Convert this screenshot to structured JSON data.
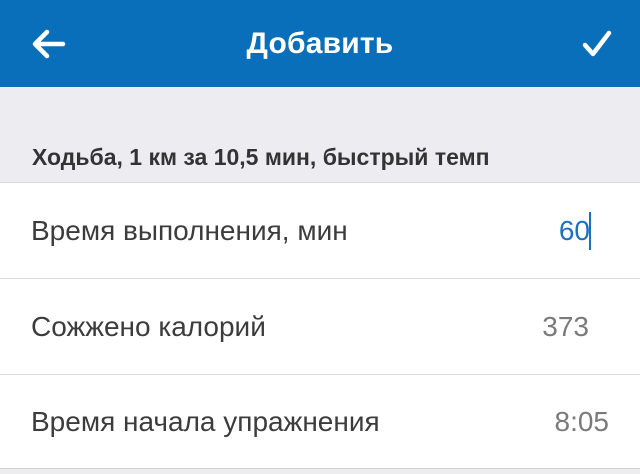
{
  "navbar": {
    "title": "Добавить",
    "back_icon": "arrow-left-icon",
    "done_icon": "checkmark-icon",
    "color": "#0a6fbb"
  },
  "exercise": {
    "title": "Ходьба, 1 км за 10,5 мин, быстрый темп"
  },
  "fields": {
    "duration": {
      "label": "Время выполнения, мин",
      "value": "60"
    },
    "calories": {
      "label": "Сожжено калорий",
      "value": "373"
    },
    "start_time": {
      "label": "Время начала упражнения",
      "value": "8:05"
    }
  }
}
